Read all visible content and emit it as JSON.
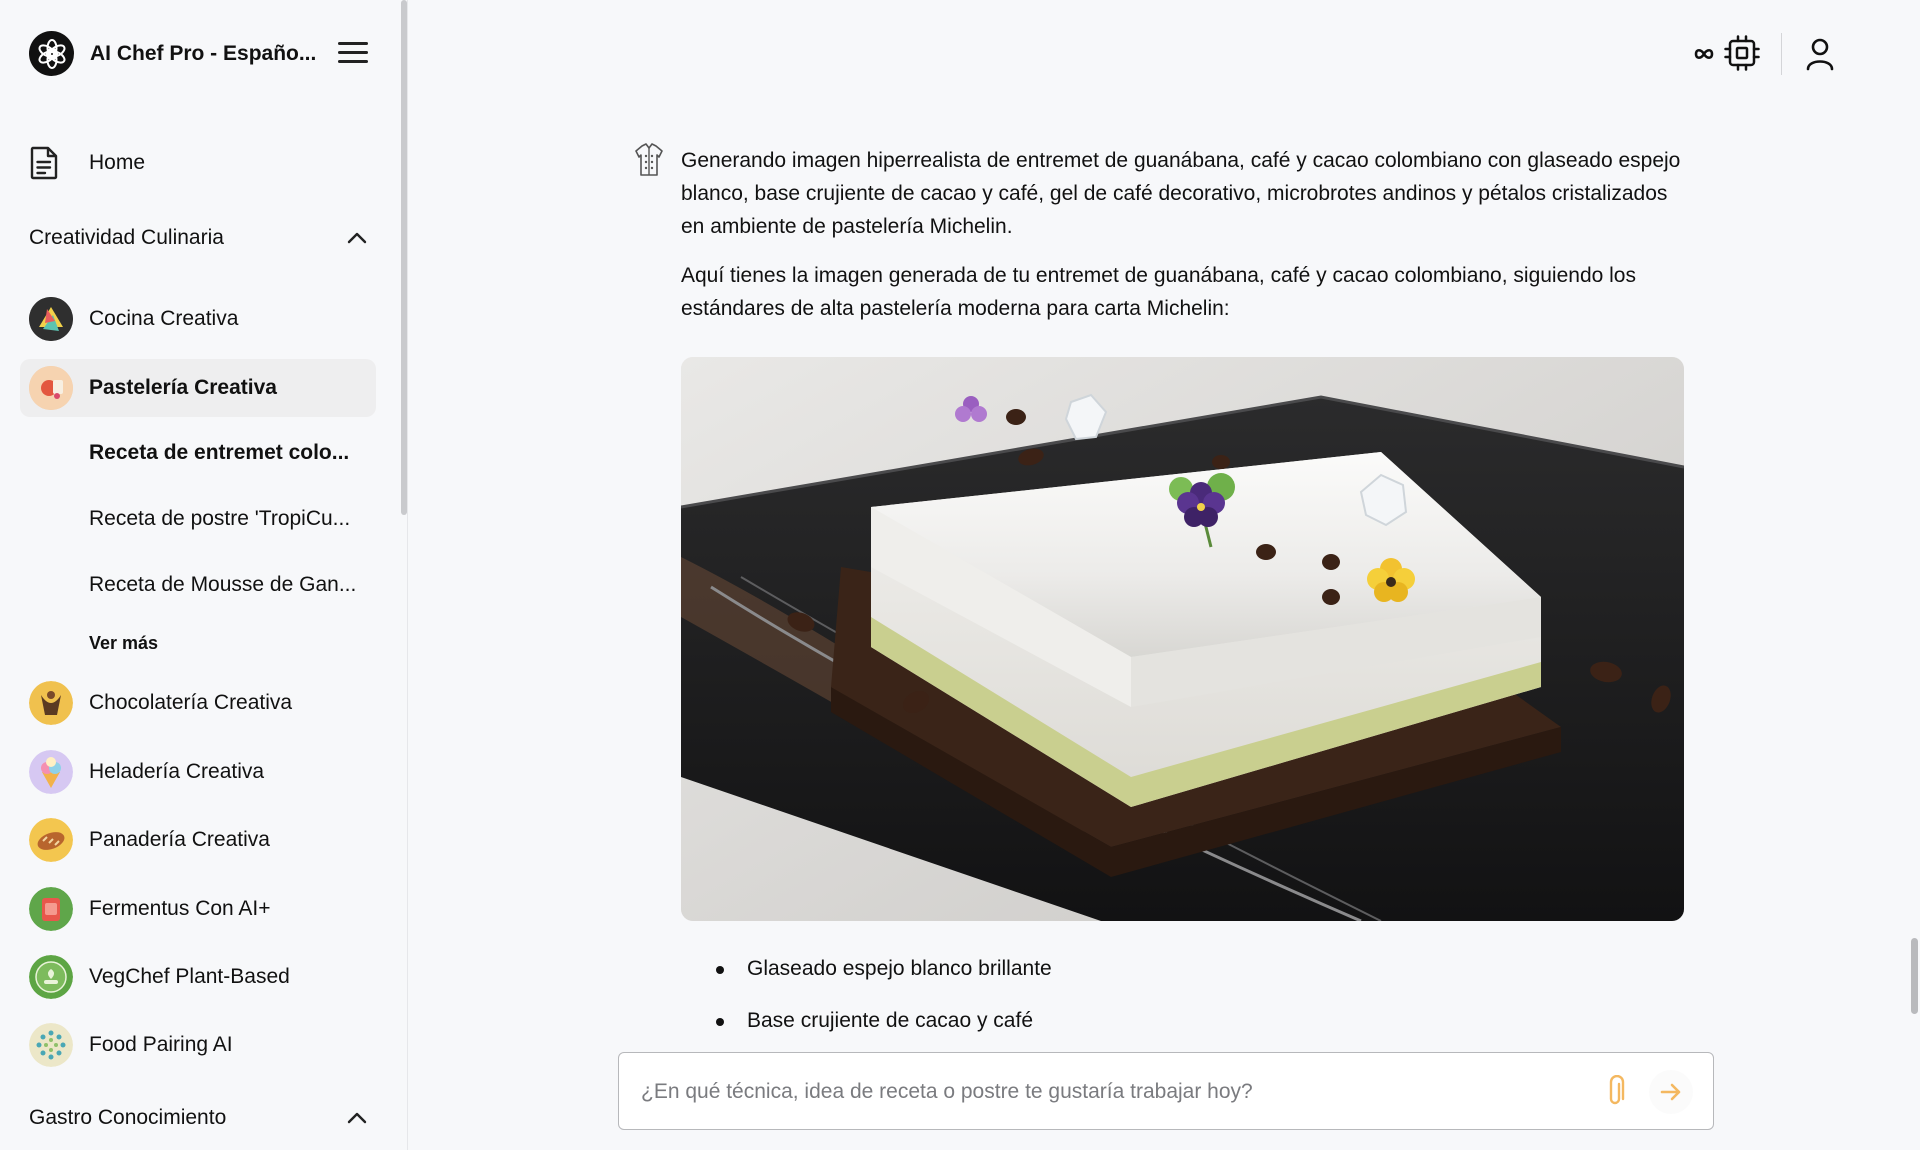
{
  "app": {
    "title": "AI Chef Pro - Español",
    "title_display": "AI Chef Pro - Españo..."
  },
  "sidebar": {
    "home_label": "Home",
    "sections": [
      {
        "label": "Creatividad Culinaria",
        "expanded": true
      },
      {
        "label": "Gastro Conocimiento",
        "expanded": true
      }
    ],
    "items": [
      {
        "label": "Cocina Creativa",
        "icon": "cocina-creativa-avatar",
        "color": "#f2d14a"
      },
      {
        "label": "Pastelería Creativa",
        "icon": "pasteleria-creativa-avatar",
        "color": "#f4c9a0",
        "active": true
      },
      {
        "label": "Chocolatería Creativa",
        "icon": "chocolateria-creativa-avatar",
        "color": "#f0c14e"
      },
      {
        "label": "Heladería Creativa",
        "icon": "heladeria-creativa-avatar",
        "color": "#c9b7ee"
      },
      {
        "label": "Panadería Creativa",
        "icon": "panaderia-creativa-avatar",
        "color": "#f3c64f"
      },
      {
        "label": "Fermentus Con AI+",
        "icon": "fermentus-avatar",
        "color": "#5fa64a"
      },
      {
        "label": "VegChef Plant-Based",
        "icon": "vegchef-avatar",
        "color": "#5da544"
      },
      {
        "label": "Food Pairing AI",
        "icon": "food-pairing-avatar",
        "color": "#ece7c8"
      }
    ],
    "recent_chats": [
      {
        "label": "Receta de entremet colo...",
        "active": true
      },
      {
        "label": "Receta de postre 'TropiCu..."
      },
      {
        "label": "Receta de Mousse de Gan..."
      }
    ],
    "see_more": "Ver más"
  },
  "topbar": {
    "icons": [
      "infinity-icon",
      "cpu-chip-icon",
      "user-icon"
    ]
  },
  "chat": {
    "status_message": "Generando imagen hiperrealista de entremet de guanábana, café y cacao colombiano con glaseado espejo blanco, base crujiente de cacao y café, gel de café decorativo, microbrotes andinos y pétalos cristalizados en ambiente de pastelería Michelin.",
    "reply_message": "Aquí tienes la imagen generada de tu entremet de guanábana, café y cacao colombiano, siguiendo los estándares de alta pastelería moderna para carta Michelin:",
    "bullets": [
      "Glaseado espejo blanco brillante",
      "Base crujiente de cacao y café"
    ]
  },
  "composer": {
    "placeholder": "¿En qué técnica, idea de receta o postre te gustaría trabajar hoy?",
    "value": ""
  },
  "colors": {
    "background": "#f7f8fa",
    "text": "#111111",
    "active_item": "#eeeeef",
    "send_arrow": "#f4b860"
  }
}
